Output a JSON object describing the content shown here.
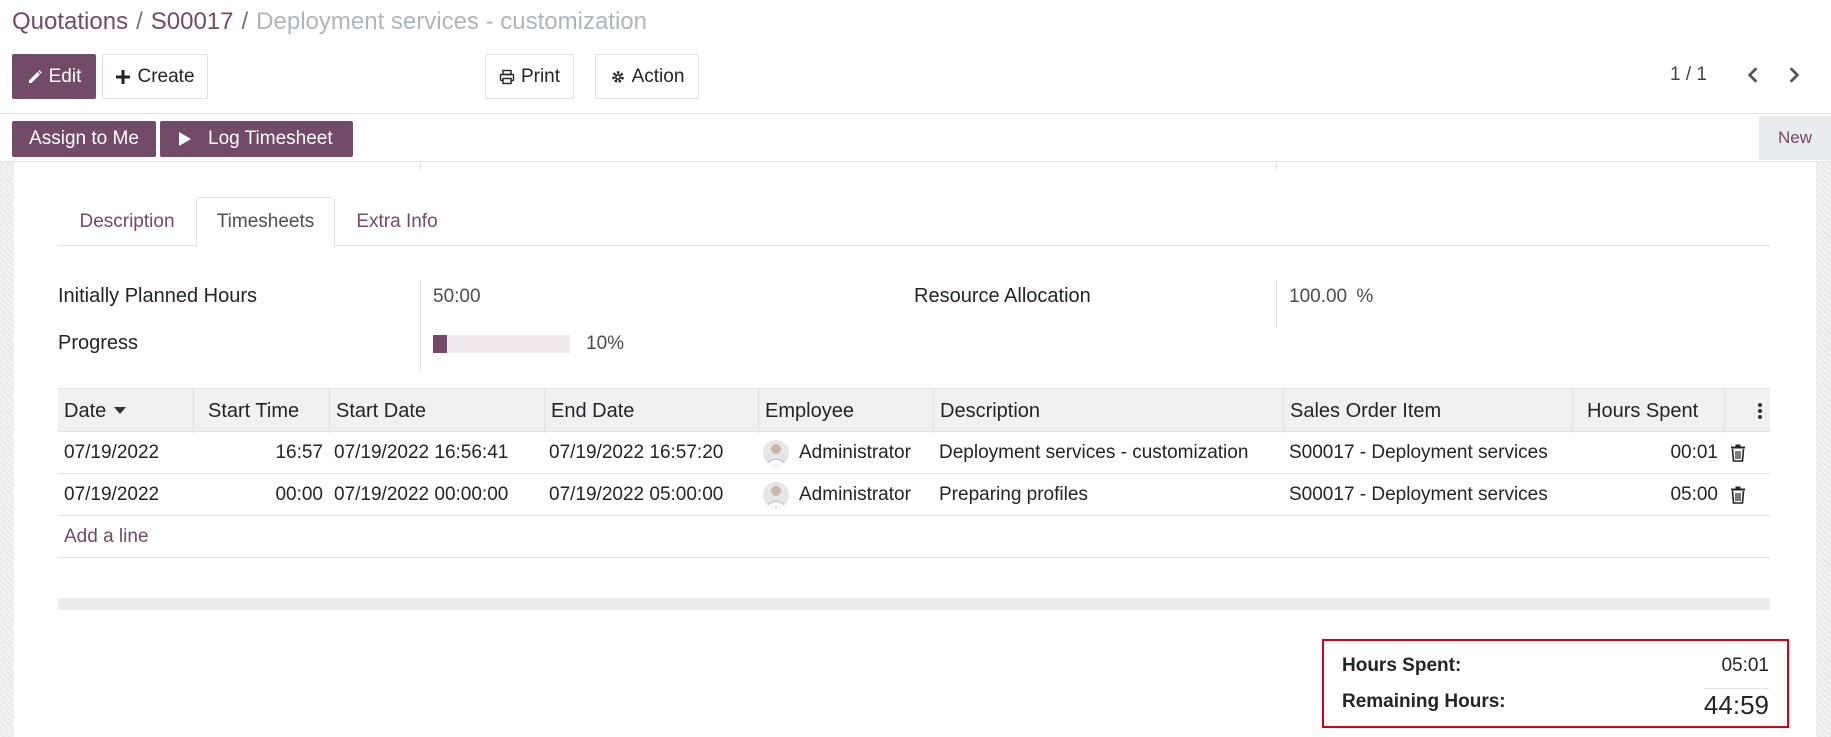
{
  "breadcrumb": {
    "root": "Quotations",
    "order": "S00017",
    "current": "Deployment services - customization",
    "separator": "/"
  },
  "toolbar": {
    "edit": "Edit",
    "create": "Create",
    "print": "Print",
    "action": "Action"
  },
  "pager": {
    "value": "1 / 1"
  },
  "statusbar": {
    "assign": "Assign to Me",
    "log_timesheet": "Log Timesheet",
    "stage": "New"
  },
  "tabs": [
    {
      "label": "Description"
    },
    {
      "label": "Timesheets",
      "active": true
    },
    {
      "label": "Extra Info"
    }
  ],
  "fields": {
    "planned_hours_label": "Initially Planned Hours",
    "planned_hours_value": "50:00",
    "resource_label": "Resource Allocation",
    "resource_value": "100.00",
    "resource_unit": "%",
    "progress_label": "Progress",
    "progress_value": 10,
    "progress_text": "10%"
  },
  "table": {
    "columns": [
      "Date",
      "Start Time",
      "Start Date",
      "End Date",
      "Employee",
      "Description",
      "Sales Order Item",
      "Hours Spent"
    ],
    "rows": [
      {
        "date": "07/19/2022",
        "start_time": "16:57",
        "start_date": "07/19/2022 16:56:41",
        "end_date": "07/19/2022 16:57:20",
        "employee": "Administrator",
        "description": "Deployment services - customization",
        "so_item": "S00017 - Deployment services",
        "hours": "00:01"
      },
      {
        "date": "07/19/2022",
        "start_time": "00:00",
        "start_date": "07/19/2022 00:00:00",
        "end_date": "07/19/2022 05:00:00",
        "employee": "Administrator",
        "description": "Preparing profiles",
        "so_item": "S00017 - Deployment services",
        "hours": "05:00"
      }
    ],
    "add_line": "Add a line"
  },
  "totals": {
    "hours_spent_label": "Hours Spent:",
    "hours_spent_value": "05:01",
    "remaining_label": "Remaining Hours:",
    "remaining_value": "44:59"
  },
  "colors": {
    "brand": "#714b67",
    "highlight": "#d0021b"
  }
}
